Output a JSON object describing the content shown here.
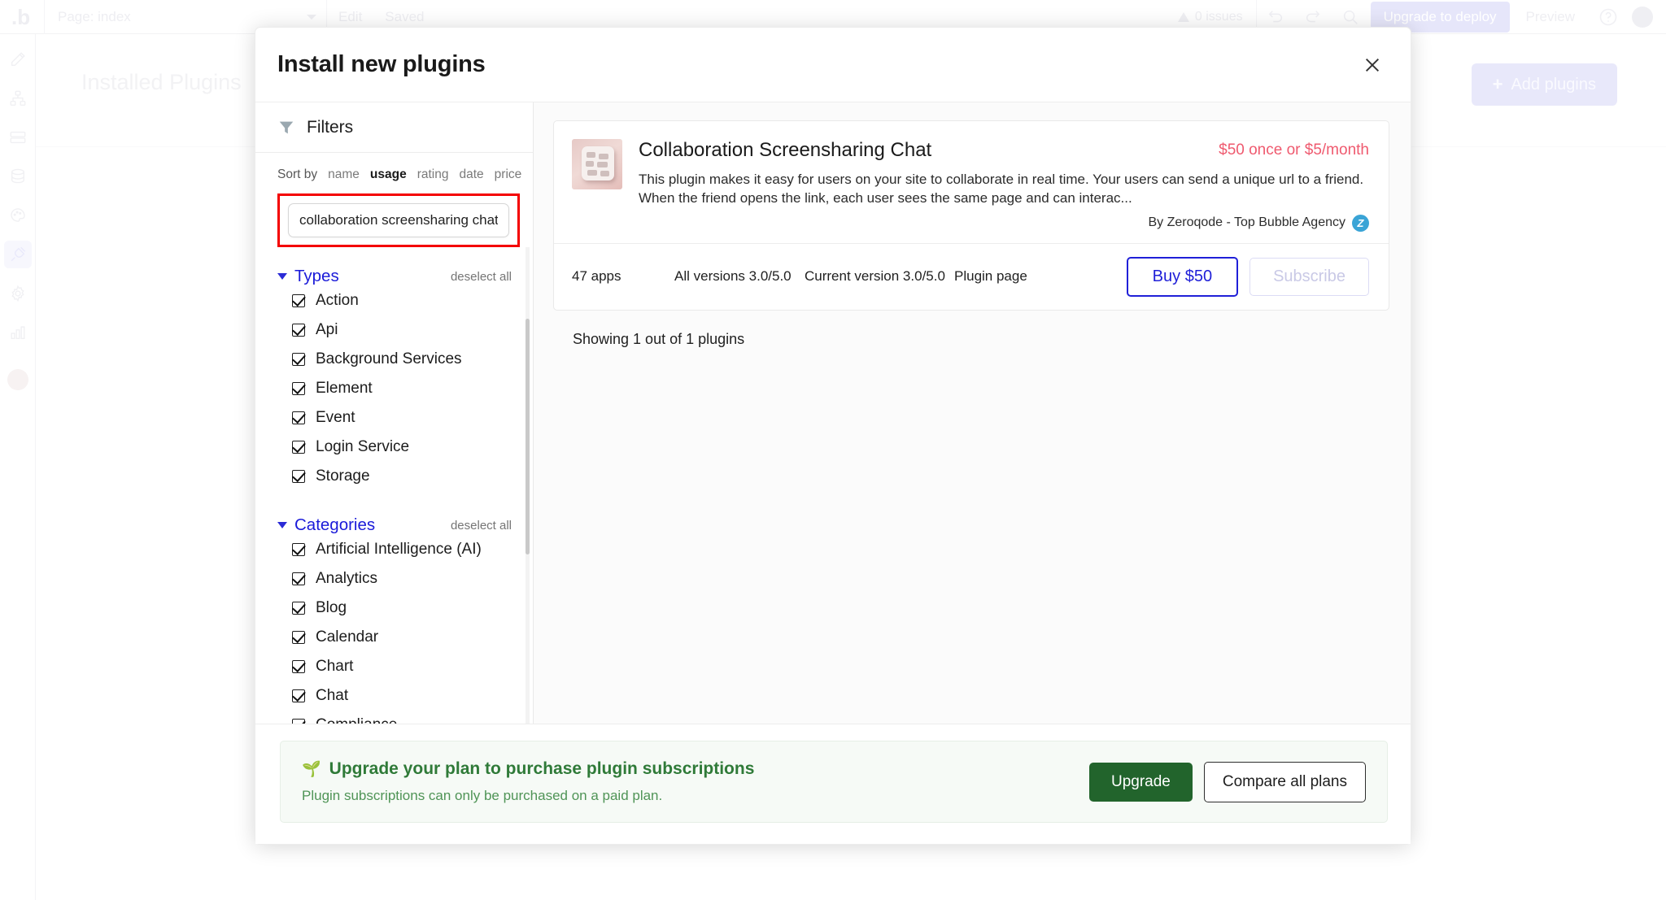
{
  "topbar": {
    "logo": "bubble-logo",
    "page_selector": "Page: index",
    "edit_tab": "Edit",
    "saved_status": "Saved",
    "issues": "0 issues",
    "undo_icon": "undo-icon",
    "redo_icon": "redo-icon",
    "search_icon": "search-icon",
    "upgrade_deploy": "Upgrade to deploy",
    "preview": "Preview",
    "help_icon": "help-icon",
    "account_icon": "account-avatar"
  },
  "left_rail": [
    {
      "icon": "pencil-icon"
    },
    {
      "icon": "workflow-icon"
    },
    {
      "icon": "data-rows-icon"
    },
    {
      "icon": "database-icon"
    },
    {
      "icon": "styles-palette-icon"
    },
    {
      "icon": "plugins-plug-icon"
    },
    {
      "icon": "settings-gear-icon"
    },
    {
      "icon": "logs-chart-icon"
    }
  ],
  "background_page": {
    "title": "Installed Plugins",
    "add_plugins_label": "Add plugins",
    "add_plugins_icon": "plus-icon"
  },
  "modal": {
    "title": "Install new plugins",
    "close_icon": "close-icon"
  },
  "filters": {
    "header_label": "Filters",
    "funnel_icon": "funnel-icon",
    "sort_by_label": "Sort by",
    "sort_options": [
      {
        "label": "name",
        "selected": false
      },
      {
        "label": "usage",
        "selected": true
      },
      {
        "label": "rating",
        "selected": false
      },
      {
        "label": "date",
        "selected": false
      },
      {
        "label": "price",
        "selected": false
      }
    ],
    "search": {
      "value": "collaboration screensharing chat",
      "placeholder": "search"
    },
    "groups": [
      {
        "title": "Types",
        "deselect_label": "deselect all",
        "items": [
          {
            "label": "Action",
            "checked": true
          },
          {
            "label": "Api",
            "checked": true
          },
          {
            "label": "Background Services",
            "checked": true
          },
          {
            "label": "Element",
            "checked": true
          },
          {
            "label": "Event",
            "checked": true
          },
          {
            "label": "Login Service",
            "checked": true
          },
          {
            "label": "Storage",
            "checked": true
          }
        ]
      },
      {
        "title": "Categories",
        "deselect_label": "deselect all",
        "items": [
          {
            "label": "Artificial Intelligence (AI)",
            "checked": true
          },
          {
            "label": "Analytics",
            "checked": true
          },
          {
            "label": "Blog",
            "checked": true
          },
          {
            "label": "Calendar",
            "checked": true
          },
          {
            "label": "Chart",
            "checked": true
          },
          {
            "label": "Chat",
            "checked": true
          },
          {
            "label": "Compliance",
            "checked": true
          }
        ]
      }
    ]
  },
  "results": {
    "showing_text": "Showing 1 out of 1 plugins",
    "plugin": {
      "thumbnail_icon": "plugin-thumbnail",
      "title": "Collaboration Screensharing Chat",
      "price": "$50 once or $5/month",
      "description": "This plugin makes it easy for users on your site to collaborate in real time. Your users can send a unique url to a friend. When the friend opens the link, each user sees the same page and can interac...",
      "author": "By Zeroqode - Top Bubble Agency",
      "author_badge": "Z",
      "apps_count": "47 apps",
      "all_versions": "All versions 3.0/5.0",
      "current_version": "Current version 3.0/5.0",
      "plugin_page_link": "Plugin page",
      "buy_label": "Buy $50",
      "subscribe_label": "Subscribe"
    }
  },
  "upgrade_banner": {
    "icon": "sprout-icon",
    "heading": "Upgrade your plan to purchase plugin subscriptions",
    "subtext": "Plugin subscriptions can only be purchased on a paid plan.",
    "upgrade_label": "Upgrade",
    "compare_label": "Compare all plans"
  },
  "colors": {
    "accent_blue": "#2020d8",
    "price_red": "#ef5a6f",
    "green": "#22642c",
    "highlight_red": "#f40000"
  }
}
